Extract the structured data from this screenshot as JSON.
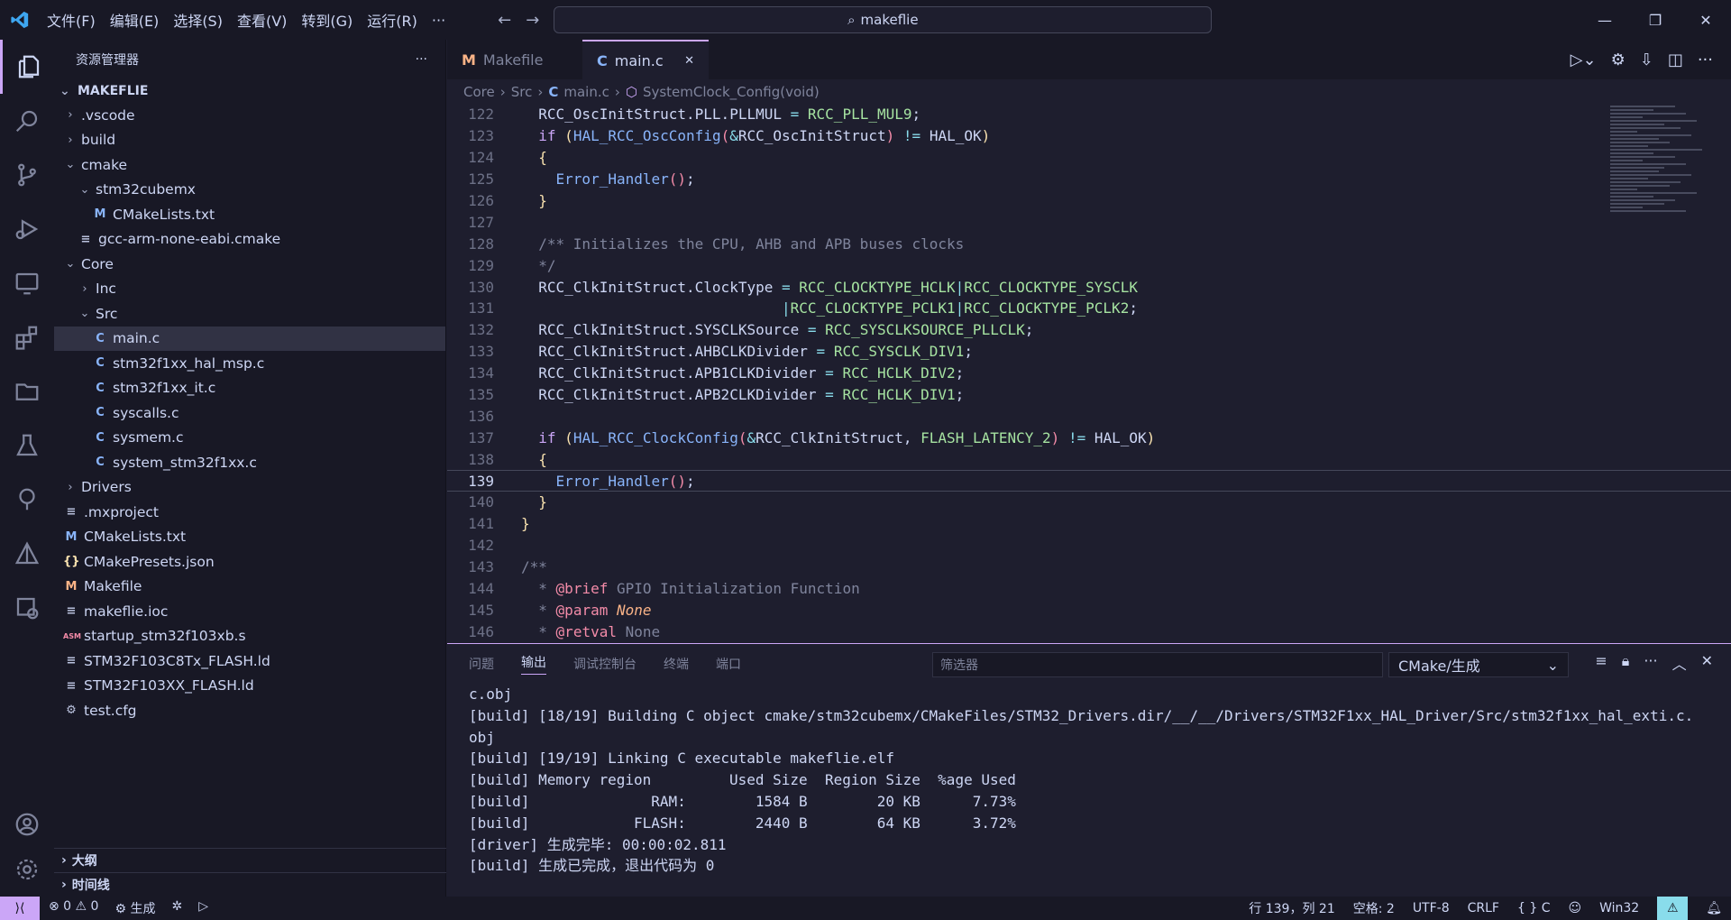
{
  "menu": [
    "文件(F)",
    "编辑(E)",
    "选择(S)",
    "查看(V)",
    "转到(G)",
    "运行(R)",
    "···"
  ],
  "command_center": "makeflie",
  "sidebar": {
    "title": "资源管理器",
    "root": "MAKEFLIE",
    "items": [
      {
        "label": ".vscode",
        "icon": "folder",
        "chev": "›",
        "indent": 1
      },
      {
        "label": "build",
        "icon": "folder",
        "chev": "›",
        "indent": 1
      },
      {
        "label": "cmake",
        "icon": "folder",
        "chev": "⌄",
        "indent": 1
      },
      {
        "label": "stm32cubemx",
        "icon": "folder",
        "chev": "⌄",
        "indent": 2
      },
      {
        "label": "CMakeLists.txt",
        "icon": "M",
        "indent": 3
      },
      {
        "label": "gcc-arm-none-eabi.cmake",
        "icon": "≡",
        "indent": 2
      },
      {
        "label": "Core",
        "icon": "folder",
        "chev": "⌄",
        "indent": 1
      },
      {
        "label": "Inc",
        "icon": "folder",
        "chev": "›",
        "indent": 2
      },
      {
        "label": "Src",
        "icon": "folder",
        "chev": "⌄",
        "indent": 2
      },
      {
        "label": "main.c",
        "icon": "C",
        "indent": 3,
        "selected": true
      },
      {
        "label": "stm32f1xx_hal_msp.c",
        "icon": "C",
        "indent": 3
      },
      {
        "label": "stm32f1xx_it.c",
        "icon": "C",
        "indent": 3
      },
      {
        "label": "syscalls.c",
        "icon": "C",
        "indent": 3
      },
      {
        "label": "sysmem.c",
        "icon": "C",
        "indent": 3
      },
      {
        "label": "system_stm32f1xx.c",
        "icon": "C",
        "indent": 3
      },
      {
        "label": "Drivers",
        "icon": "folder",
        "chev": "›",
        "indent": 1
      },
      {
        "label": ".mxproject",
        "icon": "≡",
        "indent": 1
      },
      {
        "label": "CMakeLists.txt",
        "icon": "M",
        "indent": 1
      },
      {
        "label": "CMakePresets.json",
        "icon": "{}",
        "indent": 1
      },
      {
        "label": "Makefile",
        "icon": "M2",
        "indent": 1
      },
      {
        "label": "makeflie.ioc",
        "icon": "≡",
        "indent": 1
      },
      {
        "label": "startup_stm32f103xb.s",
        "icon": "ASM",
        "indent": 1
      },
      {
        "label": "STM32F103C8Tx_FLASH.ld",
        "icon": "≡",
        "indent": 1
      },
      {
        "label": "STM32F103XX_FLASH.ld",
        "icon": "≡",
        "indent": 1
      },
      {
        "label": "test.cfg",
        "icon": "gear",
        "indent": 1
      }
    ],
    "outline": "大纲",
    "timeline": "时间线"
  },
  "tabs": [
    {
      "label": "Makefile",
      "icon": "M"
    },
    {
      "label": "main.c",
      "icon": "C",
      "close": "✕"
    }
  ],
  "breadcrumb": [
    "Core",
    "Src",
    "main.c",
    "SystemClock_Config(void)"
  ],
  "code_lines": [
    {
      "n": "122",
      "html": "  <span class='t'>RCC_OscInitStruct.PLL.PLLMUL</span> <span class='p'>=</span> <span class='c'>RCC_PLL_MUL9</span><span class='t'>;</span>"
    },
    {
      "n": "123",
      "html": "  <span class='k'>if</span> <span class='y'>(</span><span class='f'>HAL_RCC_OscConfig</span><span class='r'>(</span><span class='p'>&amp;</span><span class='t'>RCC_OscInitStruct</span><span class='r'>)</span> <span class='p'>!=</span> <span class='t'>HAL_OK</span><span class='y'>)</span>"
    },
    {
      "n": "124",
      "html": "  <span class='y'>{</span>"
    },
    {
      "n": "125",
      "html": "    <span class='f'>Error_Handler</span><span class='r'>()</span><span class='t'>;</span>"
    },
    {
      "n": "126",
      "html": "  <span class='y'>}</span>"
    },
    {
      "n": "127",
      "html": ""
    },
    {
      "n": "128",
      "html": "  <span class='m'>/** Initializes the CPU, AHB and APB buses clocks</span>"
    },
    {
      "n": "129",
      "html": "  <span class='m'>*/</span>"
    },
    {
      "n": "130",
      "html": "  <span class='t'>RCC_ClkInitStruct.ClockType</span> <span class='p'>=</span> <span class='c'>RCC_CLOCKTYPE_HCLK</span><span class='p'>|</span><span class='c'>RCC_CLOCKTYPE_SYSCLK</span>"
    },
    {
      "n": "131",
      "html": "                              <span class='p'>|</span><span class='c'>RCC_CLOCKTYPE_PCLK1</span><span class='p'>|</span><span class='c'>RCC_CLOCKTYPE_PCLK2</span><span class='t'>;</span>"
    },
    {
      "n": "132",
      "html": "  <span class='t'>RCC_ClkInitStruct.SYSCLKSource</span> <span class='p'>=</span> <span class='c'>RCC_SYSCLKSOURCE_PLLCLK</span><span class='t'>;</span>"
    },
    {
      "n": "133",
      "html": "  <span class='t'>RCC_ClkInitStruct.AHBCLKDivider</span> <span class='p'>=</span> <span class='c'>RCC_SYSCLK_DIV1</span><span class='t'>;</span>"
    },
    {
      "n": "134",
      "html": "  <span class='t'>RCC_ClkInitStruct.APB1CLKDivider</span> <span class='p'>=</span> <span class='c'>RCC_HCLK_DIV2</span><span class='t'>;</span>"
    },
    {
      "n": "135",
      "html": "  <span class='t'>RCC_ClkInitStruct.APB2CLKDivider</span> <span class='p'>=</span> <span class='c'>RCC_HCLK_DIV1</span><span class='t'>;</span>"
    },
    {
      "n": "136",
      "html": ""
    },
    {
      "n": "137",
      "html": "  <span class='k'>if</span> <span class='y'>(</span><span class='f'>HAL_RCC_ClockConfig</span><span class='r'>(</span><span class='p'>&amp;</span><span class='t'>RCC_ClkInitStruct,</span> <span class='c'>FLASH_LATENCY_2</span><span class='r'>)</span> <span class='p'>!=</span> <span class='t'>HAL_OK</span><span class='y'>)</span>"
    },
    {
      "n": "138",
      "html": "  <span class='y'>{</span>"
    },
    {
      "n": "139",
      "html": "    <span class='f'>Error_Handler</span><span class='r'>()</span><span class='t'>;</span>",
      "cur": true
    },
    {
      "n": "140",
      "html": "  <span class='y'>}</span>"
    },
    {
      "n": "141",
      "html": "<span class='y'>}</span>"
    },
    {
      "n": "142",
      "html": ""
    },
    {
      "n": "143",
      "html": "<span class='m'>/**</span>"
    },
    {
      "n": "144",
      "html": "  <span class='m'>*</span> <span class='r'>@brief</span> <span class='m'>GPIO Initialization Function</span>"
    },
    {
      "n": "145",
      "html": "  <span class='m'>*</span> <span class='r'>@param</span> <span class='o'><i>None</i></span>"
    },
    {
      "n": "146",
      "html": "  <span class='m'>*</span> <span class='r'>@retval</span> <span class='m'>None</span>"
    }
  ],
  "panel": {
    "tabs": [
      "问题",
      "输出",
      "调试控制台",
      "终端",
      "端口"
    ],
    "filter_placeholder": "筛选器",
    "channel": "CMake/生成",
    "output": "c.obj\n[build] [18/19] Building C object cmake/stm32cubemx/CMakeFiles/STM32_Drivers.dir/__/__/Drivers/STM32F1xx_HAL_Driver/Src/stm32f1xx_hal_exti.c.\nobj\n[build] [19/19] Linking C executable makeflie.elf\n[build] Memory region         Used Size  Region Size  %age Used\n[build]              RAM:        1584 B        20 KB      7.73%\n[build]            FLASH:        2440 B        64 KB      3.72%\n[driver] 生成完毕: 00:00:02.811\n[build] 生成已完成，退出代码为 0"
  },
  "status": {
    "errors": "⊗ 0",
    "warnings": "⚠ 0",
    "build": "生成",
    "pos": "行 139，列 21",
    "spaces": "空格: 2",
    "encoding": "UTF-8",
    "eol": "CRLF",
    "lang": "{ } C",
    "platform": "Win32"
  },
  "colors": {
    "accent": "#cba6f7"
  }
}
